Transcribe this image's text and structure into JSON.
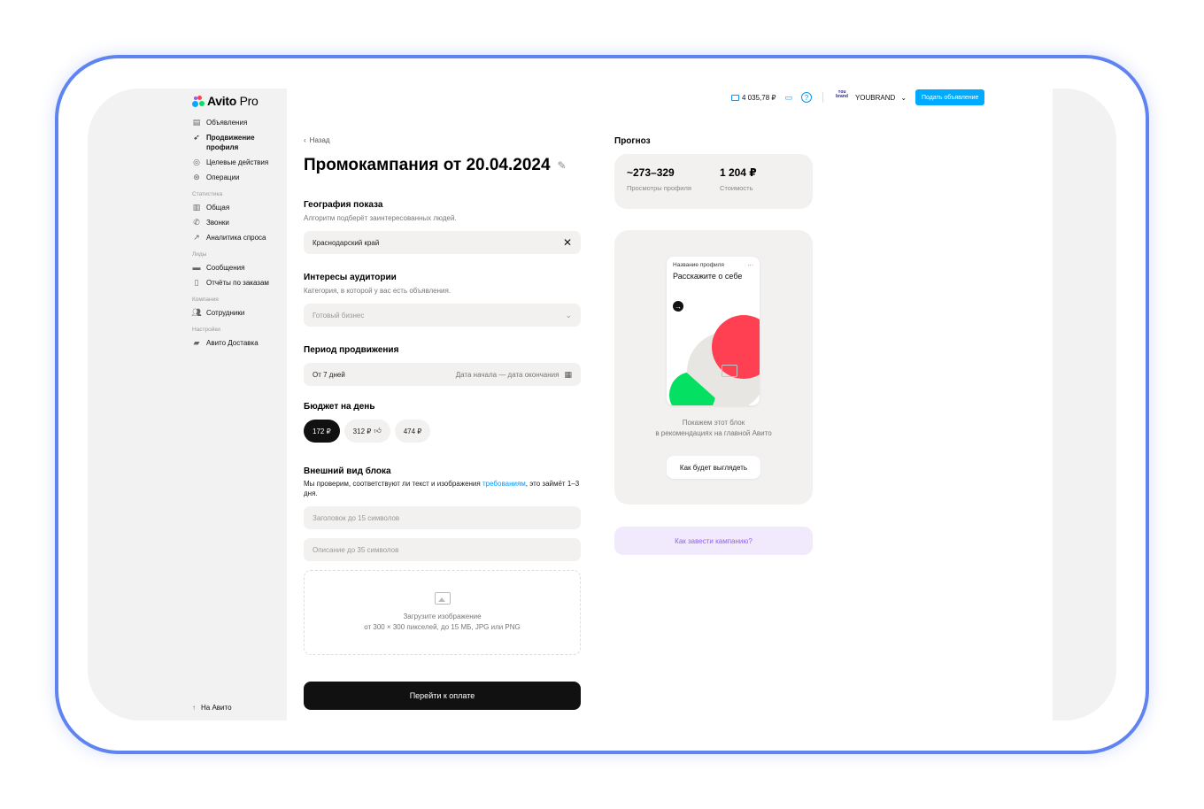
{
  "sidebar": {
    "logo": {
      "brand": "Avito",
      "suffix": " Pro"
    },
    "items": [
      {
        "icon": "listing-icon",
        "label": "Объявления"
      },
      {
        "icon": "rocket-icon",
        "label": "Продвижение профиля"
      },
      {
        "icon": "target-icon",
        "label": "Целевые действия"
      },
      {
        "icon": "operations-icon",
        "label": "Операции"
      }
    ],
    "sections": [
      {
        "title": "Статистика",
        "items": [
          {
            "icon": "bar-chart-icon",
            "label": "Общая"
          },
          {
            "icon": "phone-icon",
            "label": "Звонки"
          },
          {
            "icon": "trend-icon",
            "label": "Аналитика спроса"
          }
        ]
      },
      {
        "title": "Лиды",
        "items": [
          {
            "icon": "chat-icon",
            "label": "Сообщения"
          },
          {
            "icon": "document-icon",
            "label": "Отчёты по заказам"
          }
        ]
      },
      {
        "title": "Компания",
        "items": [
          {
            "icon": "users-icon",
            "label": "Сотрудники"
          }
        ]
      },
      {
        "title": "Настройки",
        "items": [
          {
            "icon": "truck-icon",
            "label": "Авито Доставка"
          }
        ]
      }
    ],
    "bottom_link": "На Авито"
  },
  "header": {
    "balance": "4 035,78 ₽",
    "brand_logo_text": "You brand",
    "brand_name": "YOUBRAND",
    "cta": "Подать объявление"
  },
  "main": {
    "back": "Назад",
    "title": "Промокампания от 20.04.2024",
    "geo": {
      "heading": "География показа",
      "sub": "Алгоритм подберёт заинтересованных людей.",
      "value": "Краснодарский край"
    },
    "interests": {
      "heading": "Интересы аудитории",
      "sub": "Категория, в которой у вас есть объявления.",
      "placeholder": "Готовый бизнес"
    },
    "period": {
      "heading": "Период продвижения",
      "min": "От 7 дней",
      "range_placeholder": "Дата начала — дата окончания"
    },
    "budget": {
      "heading": "Бюджет на день",
      "options": [
        "172 ₽",
        "312 ₽",
        "474 ₽"
      ],
      "selected_index": 0
    },
    "appearance": {
      "heading": "Внешний вид блока",
      "sub_before": "Мы проверим, соответствуют ли текст и изображения ",
      "sub_link": "требованиям",
      "sub_after": ", это займёт 1–3 дня.",
      "title_placeholder": "Заголовок до 15 символов",
      "desc_placeholder": "Описание до 35 символов",
      "upload_title": "Загрузите изображение",
      "upload_hint": "от 300 × 300 пикселей, до 15 МБ, JPG или PNG"
    },
    "pay_button": "Перейти к оплате"
  },
  "forecast": {
    "heading": "Прогноз",
    "views_value": "~273–329",
    "views_label": "Просмотры профиля",
    "cost_value": "1 204 ₽",
    "cost_label": "Стоимость"
  },
  "preview": {
    "card_title": "Название профиля",
    "card_text": "Расскажите о себе",
    "note_line1": "Покажем этот блок",
    "note_line2": "в рекомендациях на главной Авито",
    "button": "Как будет выглядеть"
  },
  "help_link": "Как завести кампанию?",
  "colors": {
    "accent_blue": "#00aaff",
    "frame_blue": "#5f84f2",
    "red": "#ff4053",
    "green": "#04e061",
    "purple": "#965eeb"
  }
}
